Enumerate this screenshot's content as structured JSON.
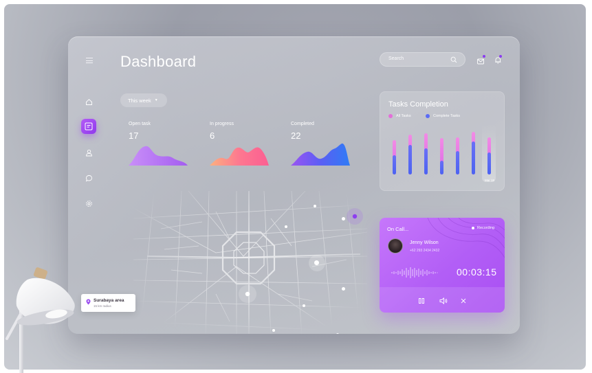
{
  "header": {
    "title": "Dashboard",
    "search_placeholder": "Search"
  },
  "icons": {
    "menu": "menu-icon",
    "search": "search-icon",
    "mail": "mail-icon",
    "bell": "bell-icon",
    "nav": [
      "home-icon",
      "document-icon",
      "user-icon",
      "chat-icon",
      "settings-icon"
    ]
  },
  "filter": {
    "label": "This week"
  },
  "stats": [
    {
      "label": "Open task",
      "value": "17"
    },
    {
      "label": "In progress",
      "value": "6"
    },
    {
      "label": "Completed",
      "value": "22"
    }
  ],
  "tasks_completion": {
    "title": "Tasks Completion",
    "legend": [
      {
        "label": "All Tasks",
        "color": "#e46fd9"
      },
      {
        "label": "Complete Tasks",
        "color": "#5b6cf5"
      }
    ],
    "date_label": "Mar 18"
  },
  "call": {
    "status": "On Call...",
    "recording": "Recording",
    "name": "Jenny Wilson",
    "phone": "+62 293 2434 2432",
    "timer": "00:03:15"
  },
  "map_tag": {
    "name": "Surabaya area",
    "sub": "15 km radius"
  },
  "colors": {
    "accent": "#a94ff2",
    "open_task": "#c48af7",
    "in_progress": "#fd6f8d",
    "completed": "#4e5cf3"
  }
}
